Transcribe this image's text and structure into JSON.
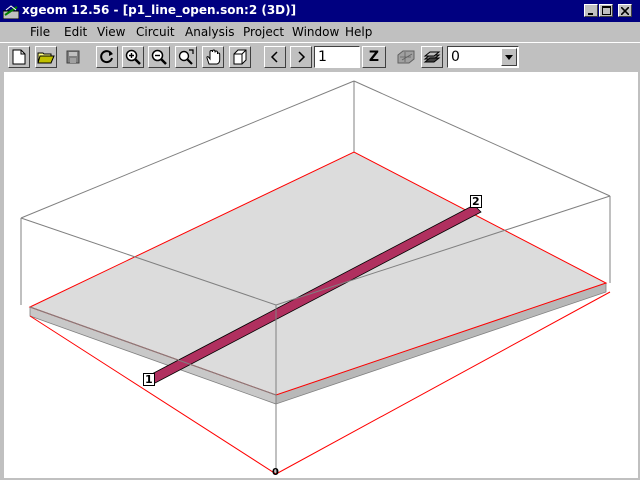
{
  "window": {
    "title": "xgeom 12.56 - [p1_line_open.son:2 (3D)]"
  },
  "menu": {
    "items": [
      {
        "label": "File"
      },
      {
        "label": "Edit"
      },
      {
        "label": "View"
      },
      {
        "label": "Circuit"
      },
      {
        "label": "Analysis"
      },
      {
        "label": "Project"
      },
      {
        "label": "Window"
      },
      {
        "label": "Help"
      }
    ]
  },
  "toolbar": {
    "level_value": "1",
    "z_label": "Z",
    "layer_value": "0"
  },
  "canvas": {
    "port1_label": "1",
    "port2_label": "2",
    "origin_label": "0"
  },
  "colors": {
    "title_bg": "#000080",
    "metal": "#b0305f",
    "substrate": "#dcdcdc",
    "box_edge": "#ff0000"
  }
}
